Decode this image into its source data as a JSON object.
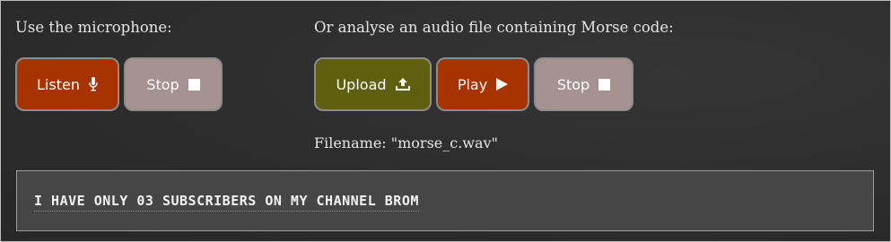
{
  "microphone": {
    "heading": "Use the microphone:",
    "listen_label": "Listen",
    "listen_icon": "microphone-icon",
    "stop_label": "Stop",
    "stop_icon": "stop-square-icon"
  },
  "audio_file": {
    "heading": "Or analyse an audio file containing Morse code:",
    "upload_label": "Upload",
    "upload_icon": "upload-icon",
    "play_label": "Play",
    "play_icon": "play-icon",
    "stop_label": "Stop",
    "stop_icon": "stop-square-icon",
    "filename_text": "Filename: \"morse_c.wav\""
  },
  "output": {
    "decoded_text": "I HAVE ONLY 03 SUBSCRIBERS ON MY CHANNEL BROM"
  },
  "colors": {
    "background": "#2e2e2e",
    "red_button": "#a63300",
    "grey_button": "#a69290",
    "olive_button": "#5f5f0f",
    "output_box": "#464646"
  }
}
